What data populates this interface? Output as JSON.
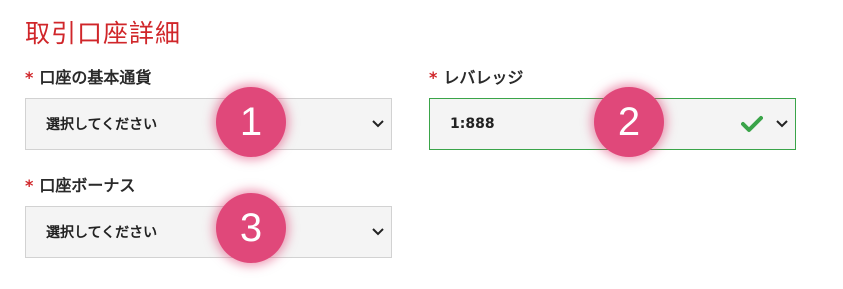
{
  "title": "取引口座詳細",
  "required_mark": "*",
  "fields": [
    {
      "label": "口座の基本通貨",
      "value": "選択してください",
      "valid": false
    },
    {
      "label": "レバレッジ",
      "value": "1:888",
      "valid": true
    },
    {
      "label": "口座ボーナス",
      "value": "選択してください",
      "valid": false
    }
  ],
  "badges": [
    "1",
    "2",
    "3"
  ],
  "colors": {
    "accent_red": "#d0262a",
    "badge_pink": "#e0487a",
    "valid_green": "#3aa449",
    "select_bg": "#f4f4f4"
  },
  "icons": {
    "dropdown": "chevron-down-icon",
    "valid": "checkmark-icon"
  }
}
